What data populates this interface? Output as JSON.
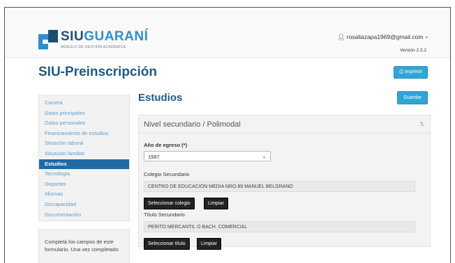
{
  "header": {
    "logo_siu": "SIU",
    "logo_guarani": "GUARANÍ",
    "logo_sub": "MÓDULO DE GESTIÓN ACADÉMICA",
    "user_email": "rosaliazapa1969@gmail.com",
    "user_icon": "user-icon",
    "version": "Versión 2.3.2"
  },
  "page": {
    "title": "SIU-Preinscripción",
    "print_label": "Imprimir",
    "print_icon": "print-icon"
  },
  "sidebar": {
    "items": [
      {
        "label": "Carrera",
        "active": false
      },
      {
        "label": "Datos principales",
        "active": false
      },
      {
        "label": "Datos personales",
        "active": false
      },
      {
        "label": "Financiamiento de estudios",
        "active": false
      },
      {
        "label": "Situación laboral",
        "active": false
      },
      {
        "label": "Situación familiar",
        "active": false
      },
      {
        "label": "Estudios",
        "active": true
      },
      {
        "label": "Tecnología",
        "active": false
      },
      {
        "label": "Deportes",
        "active": false
      },
      {
        "label": "Idiomas",
        "active": false
      },
      {
        "label": "Discapacidad",
        "active": false
      },
      {
        "label": "Documentación",
        "active": false
      }
    ],
    "info_text": "Completá los campos de este formulario. Una vez completado"
  },
  "content": {
    "title": "Estudios",
    "save_label": "Guardar",
    "panel": {
      "title": "Nivel secundario / Polimodal",
      "collapse_icon": "collapse-icon",
      "year_label": "Año de egreso (*)",
      "year_value": "1987",
      "school_label": "Colegio Secundario",
      "school_value": "CENTRO DE EDUCACION MEDIA NRO.89 MANUEL BELGRANO",
      "select_school_label": "Seleccionar colegio",
      "clear_school_label": "Limpiar",
      "degree_label": "Título Secundario",
      "degree_value": "PERITO MERCANTIL O BACH. COMERCIAL",
      "select_degree_label": "Seleccionar título",
      "clear_degree_label": "Limpiar"
    }
  },
  "colors": {
    "primary": "#1f5a85",
    "accent": "#2fa6d6",
    "sidebar_active": "#1d6aa6",
    "link": "#5b9ccc"
  }
}
